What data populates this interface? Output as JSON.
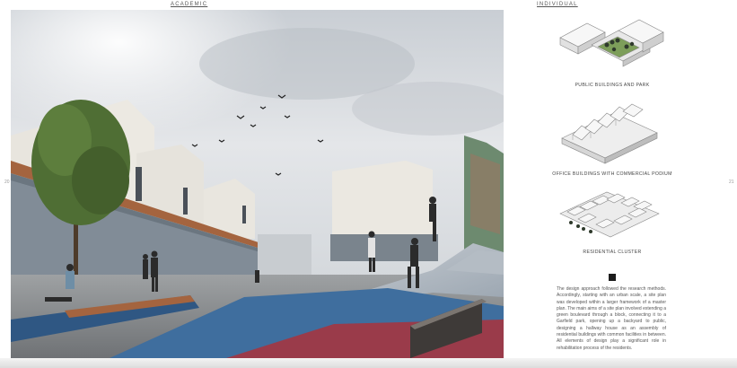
{
  "tabs": {
    "left": "ACADEMIC",
    "right": "INDIVIDUAL"
  },
  "page_numbers": {
    "left": "20",
    "right": "21"
  },
  "diagrams": [
    {
      "caption": "PUBLIC BUILDINGS AND PARK"
    },
    {
      "caption": "OFFICE BUILDINGS WITH COMMERCIAL PODIUM"
    },
    {
      "caption": "RESIDENTIAL CLUSTER"
    }
  ],
  "description": "The design approach followed the research methods. Accordingly, starting with an urban scale, a site plan was developed within a larger framework of a master plan. The main aims of a site plan involved extending a green boulevard through a block, connecting it to a Garfield park, opening up a backyard to public, designing a hallway house as an assembly of residential buildings with common facilities in between. All elements of design play a significant role in rehabilitation process of the residents.",
  "colors": {
    "sky": "#d9dde2",
    "building_white": "#ebe8e1",
    "pavement_blue": "#3f6e9e",
    "pavement_red": "#9a3b4a",
    "tree_green": "#4f6e34",
    "timber": "#a4643f"
  }
}
